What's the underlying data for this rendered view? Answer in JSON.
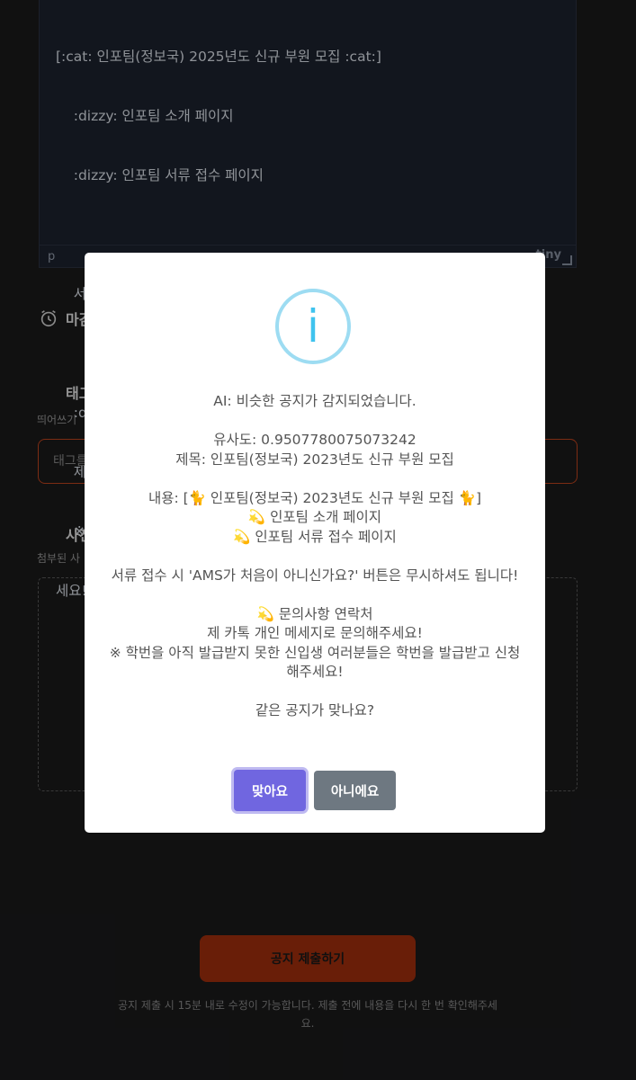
{
  "editor": {
    "lines": [
      "[:cat: 인포팀(정보국) 2025년도 신규 부원 모집 :cat:]",
      "    :dizzy: 인포팀 소개 페이지",
      "    :dizzy: 인포팀 서류 접수 페이지",
      "",
      "    서류 접수 시 'AMS가 처음이 아니신가요?' 버튼은 무시하셔도 됩니다!",
      "",
      "    :dizzy: 문의사항 연락처",
      "    제 카톡 개인 메세지로 문의해주세요!",
      "    ※ 학번을 아직 발급받지 못한 신입생 여러분들은 학번을 발급받고 신청해주",
      "세요!"
    ],
    "status_path": "p",
    "brand": "tiny"
  },
  "deadline": {
    "label": "마감",
    "icon": "alarm-clock-icon"
  },
  "tags": {
    "title": "태그",
    "help": "띄어쓰기",
    "placeholder": "태그를"
  },
  "photos": {
    "title": "사진",
    "help": "첨부된 사"
  },
  "submit": {
    "label": "공지 제출하기",
    "note": "공지 제출 시 15분 내로 수정이 가능합니다. 제출 전에 내용을 다시 한 번 확인해주세요."
  },
  "modal": {
    "icon": "info-icon",
    "icon_glyph": "i",
    "heading": "AI: 비슷한 공지가 감지되었습니다.",
    "similarity": "유사도: 0.9507780075073242",
    "title_line": "제목: 인포팀(정보국) 2023년도 신규 부원 모집",
    "content_line": "내용: [🐈 인포팀(정보국) 2023년도 신규 부원 모집 🐈]",
    "item_intro": "💫 인포팀 소개 페이지",
    "item_apply": "💫 인포팀 서류 접수 페이지",
    "notice": "서류 접수 시 'AMS가 처음이 아니신가요?' 버튼은 무시하셔도 됩니다!",
    "contact_title": "💫 문의사항 연락처",
    "contact_text": "제 카톡 개인 메세지로 문의해주세요!",
    "student_note": "※ 학번을 아직 발급받지 못한 신입생 여러분들은 학번을 발급받고 신청해주세요!",
    "question": "같은 공지가 맞나요?",
    "confirm_label": "맞아요",
    "cancel_label": "아니에요"
  },
  "colors": {
    "confirm": "#7066e0",
    "cancel": "#6e7881",
    "submit": "#a5300d",
    "info": "#3fc3ee"
  }
}
